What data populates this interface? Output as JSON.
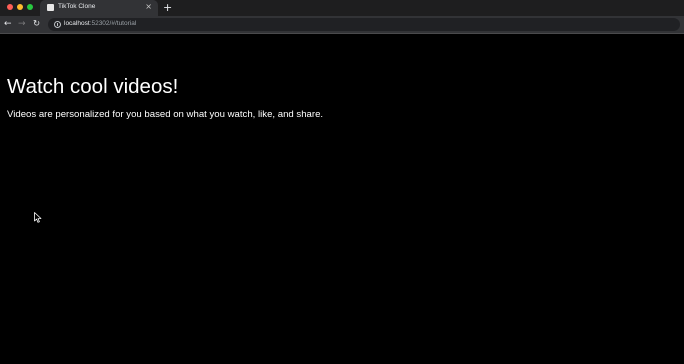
{
  "browser": {
    "tab": {
      "favicon": "page-icon",
      "title": "TikTok Clone",
      "close_glyph": "×"
    },
    "new_tab_glyph": "+",
    "toolbar": {
      "back_glyph": "←",
      "forward_glyph": "→",
      "reload_glyph": "↻",
      "url_host": "localhost",
      "url_rest": ":52302/#/tutorial"
    },
    "colors": {
      "tabstrip": "#1e1e1f",
      "toolbar": "#323336",
      "omnibox": "#202124",
      "page_background": "#000000"
    }
  },
  "page": {
    "heading": "Watch cool videos!",
    "description": "Videos are personalized for you based on what you watch, like, and share."
  }
}
